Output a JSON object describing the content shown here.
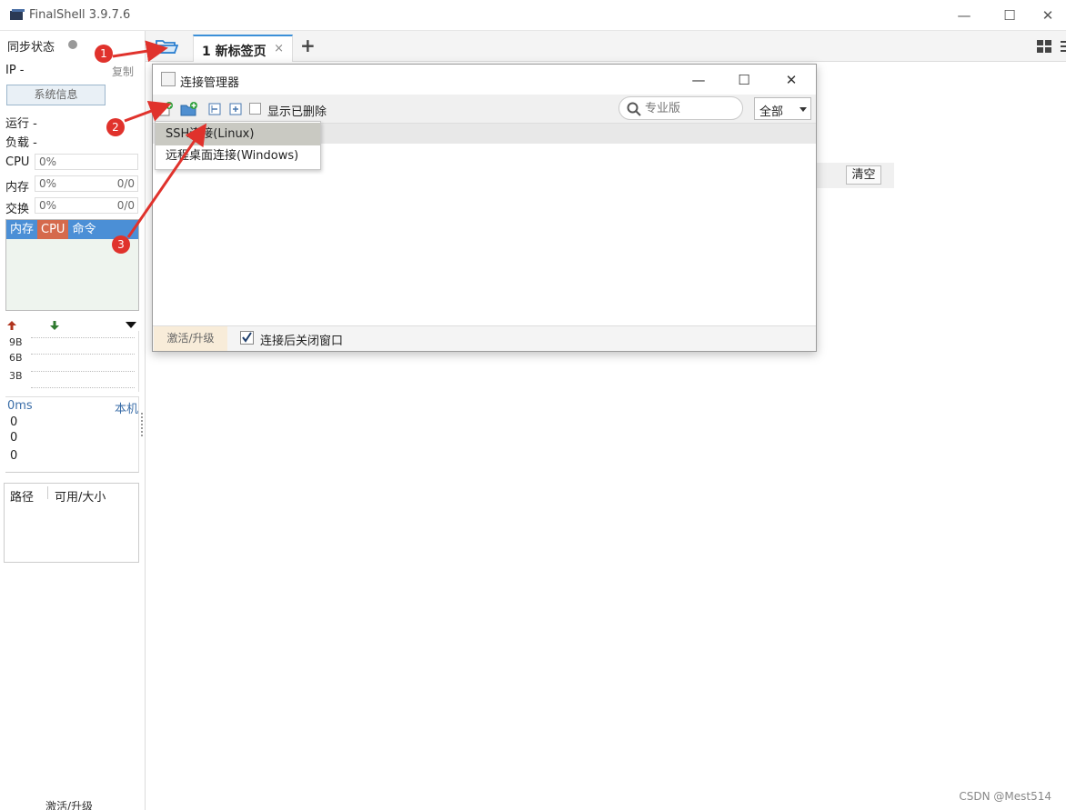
{
  "window": {
    "title": "FinalShell 3.9.7.6",
    "minimize": "—",
    "maximize": "☐",
    "close": "✕"
  },
  "sidebar": {
    "sync_status": "同步状态",
    "ip_label": "IP -",
    "copy": "复制",
    "sysinfo_button": "系统信息",
    "run": "运行 -",
    "load": "负载 -",
    "cpu_label": "CPU",
    "cpu_value": "0%",
    "mem_label": "内存",
    "mem_value": "0%",
    "mem_ratio": "0/0",
    "swap_label": "交换",
    "swap_value": "0%",
    "swap_ratio": "0/0",
    "proc_tabs": [
      "内存",
      "CPU",
      "命令"
    ],
    "net_levels": [
      "9B",
      "6B",
      "3B"
    ],
    "ping": "0ms",
    "host": "本机",
    "ping_values": [
      "0",
      "0",
      "0"
    ],
    "disk_cols": [
      "路径",
      "可用/大小"
    ],
    "bottom_upgrade": "激活/升级"
  },
  "tabs": [
    {
      "label": "1 新标签页",
      "close": "×"
    }
  ],
  "add_tab": "+",
  "background": {
    "clear_button": "清空"
  },
  "dialog": {
    "title": "连接管理器",
    "show_deleted": "显示已删除",
    "search_placeholder": "专业版",
    "filter_value": "全部",
    "upgrade": "激活/升级",
    "close_after_connect": "连接后关闭窗口",
    "close_after_checked": true
  },
  "popup_menu": {
    "items": [
      "SSH连接(Linux)",
      "远程桌面连接(Windows)"
    ]
  },
  "annotations": [
    "1",
    "2",
    "3"
  ],
  "watermark": "CSDN @Mest514",
  "colors": {
    "accent": "#3b8fd8",
    "annotation": "#e0322c",
    "cpu_tab": "#d56a4c",
    "mem_tab": "#4b8fd6"
  }
}
